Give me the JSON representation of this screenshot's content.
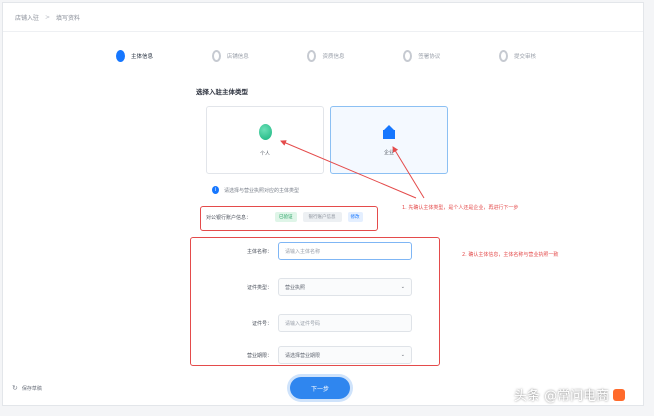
{
  "breadcrumb": {
    "items": [
      "店铺入驻",
      "填写资料"
    ],
    "separator": ">"
  },
  "stepper": {
    "steps": [
      {
        "label": "主体信息",
        "active": true
      },
      {
        "label": "店铺信息",
        "active": false
      },
      {
        "label": "资质信息",
        "active": false
      },
      {
        "label": "签署协议",
        "active": false
      },
      {
        "label": "提交审核",
        "active": false
      }
    ]
  },
  "section_title": "选择入驻主体类型",
  "cards": {
    "personal_label": "个人",
    "company_label": "企业"
  },
  "notice_text": "请选择与营业执照对应的主体类型",
  "bank_row": {
    "label": "对公银行账户信息：",
    "tag_green": "已验证",
    "tag_gray": "银行账户信息",
    "tag_blue": "修改"
  },
  "form": {
    "row1": {
      "label": "主体名称：",
      "placeholder": "请输入主体名称"
    },
    "row2": {
      "label": "证件类型：",
      "value": "营业执照"
    },
    "row3": {
      "label": "证件号：",
      "placeholder": "请输入证件号码"
    },
    "row4": {
      "label": "营业期限：",
      "placeholder": "请选择营业期限"
    }
  },
  "annotations": {
    "first": "1. 先确认主体类型，是个人还是企业，再进行下一步",
    "second": "2. 确认主体信息，主体名称与营业执照一致"
  },
  "next_button_label": "下一步",
  "save_draft_label": "保存草稿",
  "watermark": {
    "text": "头条 @常问电商"
  },
  "colors": {
    "accent": "#1677ff",
    "annotation_red": "#e44b4b",
    "success_green": "#18b37e"
  }
}
